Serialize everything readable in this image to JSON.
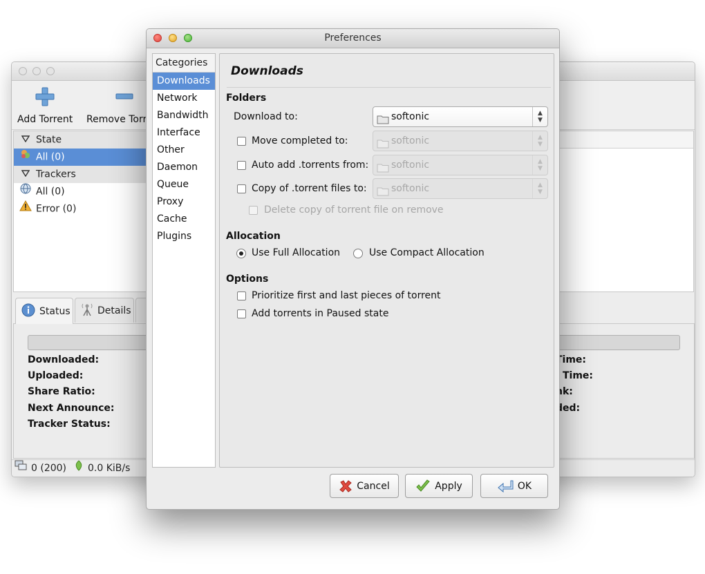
{
  "main_window": {
    "toolbar": {
      "add_torrent_label": "Add Torrent",
      "remove_torrent_label": "Remove Torr"
    },
    "sidebar": {
      "state_label": "State",
      "all_state_label": "All (0)",
      "trackers_label": "Trackers",
      "all_trackers_label": "All (0)",
      "error_label": "Error (0)"
    },
    "tabs": {
      "status_label": "Status",
      "details_label": "Details"
    },
    "details": {
      "downloaded_label": "Downloaded:",
      "uploaded_label": "Uploaded:",
      "share_ratio_label": "Share Ratio:",
      "next_announce_label": "Next Announce:",
      "tracker_status_label": "Tracker Status:",
      "right_col": [
        "Time:",
        "Time:",
        "nk:",
        "ded:"
      ]
    },
    "statusbar": {
      "connections": "0 (200)",
      "download_speed": "0.0 KiB/s"
    }
  },
  "dialog": {
    "title": "Preferences",
    "categories_header": "Categories",
    "categories": [
      "Downloads",
      "Network",
      "Bandwidth",
      "Interface",
      "Other",
      "Daemon",
      "Queue",
      "Proxy",
      "Cache",
      "Plugins"
    ],
    "selected_category": "Downloads",
    "page_title": "Downloads",
    "folders": {
      "section_label": "Folders",
      "download_to_label": "Download to:",
      "download_to_value": "softonic",
      "move_completed_label": "Move completed to:",
      "move_completed_value": "softonic",
      "auto_add_label": "Auto add .torrents from:",
      "auto_add_value": "softonic",
      "copy_torrent_label": "Copy of .torrent files to:",
      "copy_torrent_value": "softonic",
      "delete_copy_label": "Delete copy of torrent file on remove"
    },
    "allocation": {
      "section_label": "Allocation",
      "full_label": "Use Full Allocation",
      "compact_label": "Use Compact Allocation",
      "selected": "full"
    },
    "options": {
      "section_label": "Options",
      "prioritize_label": "Prioritize first and last pieces of torrent",
      "paused_label": "Add torrents in Paused state"
    },
    "buttons": {
      "cancel_label": "Cancel",
      "apply_label": "Apply",
      "ok_label": "OK"
    }
  }
}
